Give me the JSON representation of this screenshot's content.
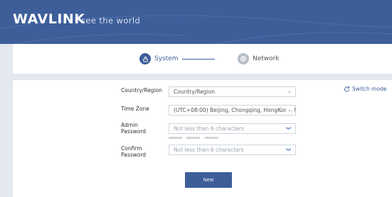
{
  "header": {
    "brand": "WAVLINK",
    "tagline": "see the world"
  },
  "steps": [
    {
      "label": "System",
      "active": true,
      "icon": "lock-icon"
    },
    {
      "label": "Network",
      "active": false,
      "icon": "globe-icon"
    }
  ],
  "form": {
    "country": {
      "label": "Country/Region",
      "value": "Country/Region"
    },
    "timezone": {
      "label": "Time Zone",
      "value": "(UTC+08:00) Beijing, Chongqing, HongKong, U"
    },
    "admin_password": {
      "label_line1": "Admin",
      "label_line2": "Password",
      "placeholder": "Not less than 6 characters"
    },
    "confirm_password": {
      "label_line1": "Confirm",
      "label_line2": "Password",
      "placeholder": "Not less than 6 characters"
    }
  },
  "switch_mode": {
    "label": "Switch mode",
    "icon": "refresh-icon"
  },
  "next_label": "Next",
  "colors": {
    "brand_blue": "#3d5e99",
    "page_bg": "#e3e9ef",
    "card_bg": "#ffffff",
    "inactive_step": "#b5bcc6"
  }
}
